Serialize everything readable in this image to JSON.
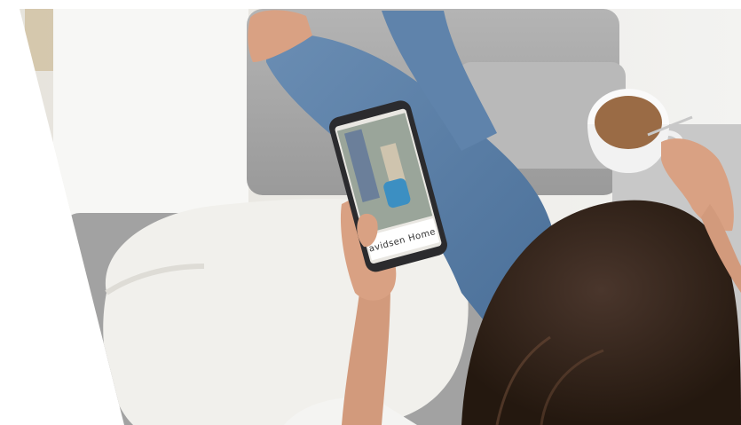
{
  "photo": {
    "phone_screen_text": "avidsen Home",
    "colors": {
      "background": "#ffffff",
      "sofa": "#a9a9a9",
      "cushion": "#f1f0ec",
      "jeans": "#5b7fa6",
      "skin": "#d9a183",
      "hair": "#3a2a22",
      "coffee": "#9a6b45",
      "wall": "#eeeeea"
    }
  }
}
